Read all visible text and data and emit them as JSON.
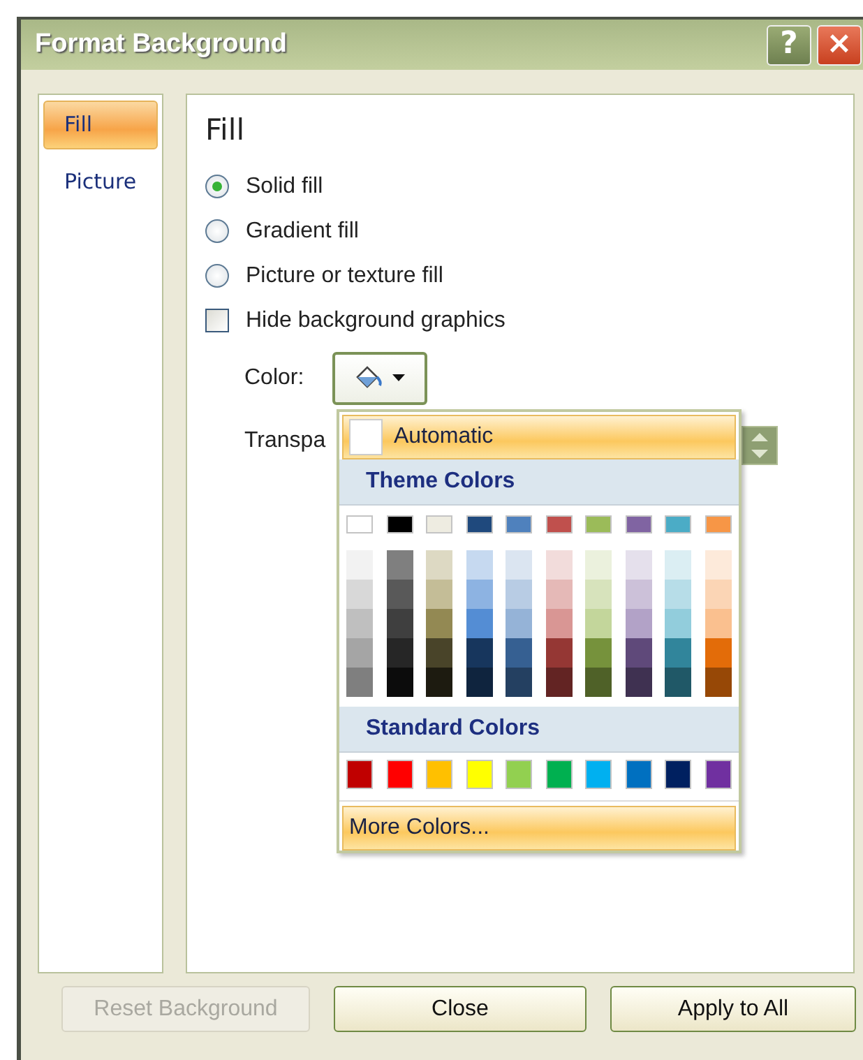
{
  "window": {
    "title": "Format Background",
    "help_button": "?",
    "close_button": "×"
  },
  "nav_items": [
    {
      "label": "Fill",
      "selected": true
    },
    {
      "label": "Picture",
      "selected": false
    }
  ],
  "section_title": "Fill",
  "fill_options": [
    {
      "kind": "radio",
      "label": "Solid fill",
      "checked": true
    },
    {
      "kind": "radio",
      "label": "Gradient fill",
      "checked": false
    },
    {
      "kind": "radio",
      "label": "Picture or texture fill",
      "checked": false
    },
    {
      "kind": "checkbox",
      "label": "Hide background graphics",
      "checked": false
    }
  ],
  "color_label": "Color:",
  "transparency_label": "Transpa",
  "color_menu": {
    "automatic": {
      "label": "Automatic",
      "highlighted": true,
      "color": "#ffffff"
    },
    "theme_heading": "Theme Colors",
    "theme_colors": [
      {
        "color": "#ffffff",
        "shades": [
          {
            "color": "#f2f2f2"
          },
          {
            "color": "#d8d8d8"
          },
          {
            "color": "#bfbfbf"
          },
          {
            "color": "#a5a5a5"
          },
          {
            "color": "#7f7f7f"
          }
        ]
      },
      {
        "color": "#000000",
        "shades": [
          {
            "color": "#7f7f7f"
          },
          {
            "color": "#595959"
          },
          {
            "color": "#3f3f3f"
          },
          {
            "color": "#262626"
          },
          {
            "color": "#0c0c0c"
          }
        ]
      },
      {
        "color": "#eeece1",
        "shades": [
          {
            "color": "#ddd9c3"
          },
          {
            "color": "#c4bd97"
          },
          {
            "color": "#938953"
          },
          {
            "color": "#494429"
          },
          {
            "color": "#1d1b10"
          }
        ]
      },
      {
        "color": "#1f497d",
        "shades": [
          {
            "color": "#c6d9f0"
          },
          {
            "color": "#8db3e2"
          },
          {
            "color": "#548dd4"
          },
          {
            "color": "#17365d"
          },
          {
            "color": "#0f243e"
          }
        ]
      },
      {
        "color": "#4f81bd",
        "shades": [
          {
            "color": "#dbe5f1"
          },
          {
            "color": "#b8cce4"
          },
          {
            "color": "#95b3d7"
          },
          {
            "color": "#366092"
          },
          {
            "color": "#244061"
          }
        ]
      },
      {
        "color": "#c0504d",
        "shades": [
          {
            "color": "#f2dcdb"
          },
          {
            "color": "#e5b9b7"
          },
          {
            "color": "#d99694"
          },
          {
            "color": "#953734"
          },
          {
            "color": "#632423"
          }
        ]
      },
      {
        "color": "#9bbb59",
        "shades": [
          {
            "color": "#ebf1dd"
          },
          {
            "color": "#d7e3bc"
          },
          {
            "color": "#c3d69b"
          },
          {
            "color": "#76923c"
          },
          {
            "color": "#4f6128"
          }
        ]
      },
      {
        "color": "#8064a2",
        "shades": [
          {
            "color": "#e5e0ec"
          },
          {
            "color": "#ccc1d9"
          },
          {
            "color": "#b2a2c7"
          },
          {
            "color": "#5f497a"
          },
          {
            "color": "#3f3151"
          }
        ]
      },
      {
        "color": "#4bacc6",
        "shades": [
          {
            "color": "#dbeef3"
          },
          {
            "color": "#b7dde8"
          },
          {
            "color": "#92cddc"
          },
          {
            "color": "#31859b"
          },
          {
            "color": "#205867"
          }
        ]
      },
      {
        "color": "#f79646",
        "shades": [
          {
            "color": "#fdeada"
          },
          {
            "color": "#fbd5b5"
          },
          {
            "color": "#fac08f"
          },
          {
            "color": "#e36c09"
          },
          {
            "color": "#974806"
          }
        ]
      }
    ],
    "standard_heading": "Standard Colors",
    "standard_colors": [
      {
        "color": "#c00000"
      },
      {
        "color": "#ff0000"
      },
      {
        "color": "#ffc000"
      },
      {
        "color": "#ffff00"
      },
      {
        "color": "#92d050"
      },
      {
        "color": "#00b050"
      },
      {
        "color": "#00b0f0"
      },
      {
        "color": "#0070c0"
      },
      {
        "color": "#002060"
      },
      {
        "color": "#7030a0"
      }
    ],
    "more_colors": {
      "label": "More Colors...",
      "highlighted": true
    }
  },
  "buttons": [
    {
      "label": "Reset Background",
      "disabled": true
    },
    {
      "label": "Close",
      "disabled": false
    },
    {
      "label": "Apply to All",
      "disabled": false
    }
  ]
}
